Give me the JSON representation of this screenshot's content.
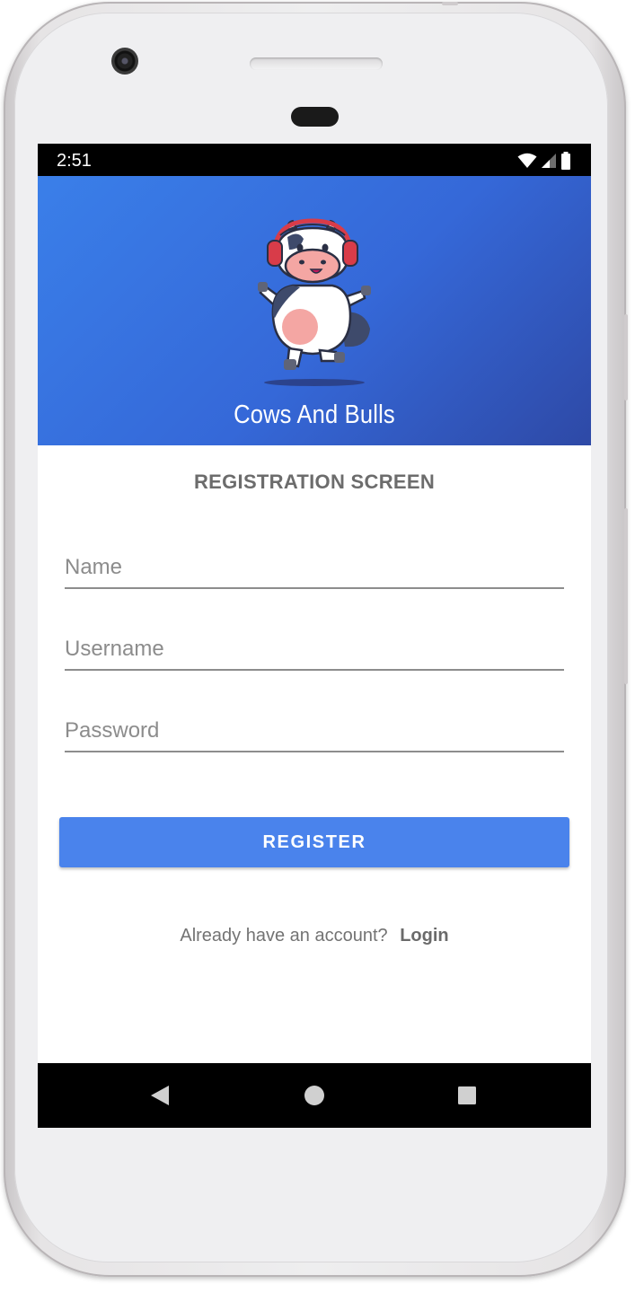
{
  "status_bar": {
    "time": "2:51",
    "icons": [
      "wifi-icon",
      "cell-signal-icon",
      "battery-icon"
    ]
  },
  "header": {
    "app_title": "Cows And Bulls",
    "mascot": "cow-mascot-with-headphones",
    "gradient_colors": [
      "#3a7fe9",
      "#2e49a6"
    ]
  },
  "form": {
    "screen_title": "REGISTRATION SCREEN",
    "name_placeholder": "Name",
    "username_placeholder": "Username",
    "password_placeholder": "Password",
    "register_label": "REGISTER",
    "button_color": "#4a83ec"
  },
  "footer": {
    "prompt": "Already have an account?",
    "login_label": "Login"
  },
  "nav_bar": {
    "icons": [
      "back-icon",
      "home-icon",
      "recents-icon"
    ]
  }
}
